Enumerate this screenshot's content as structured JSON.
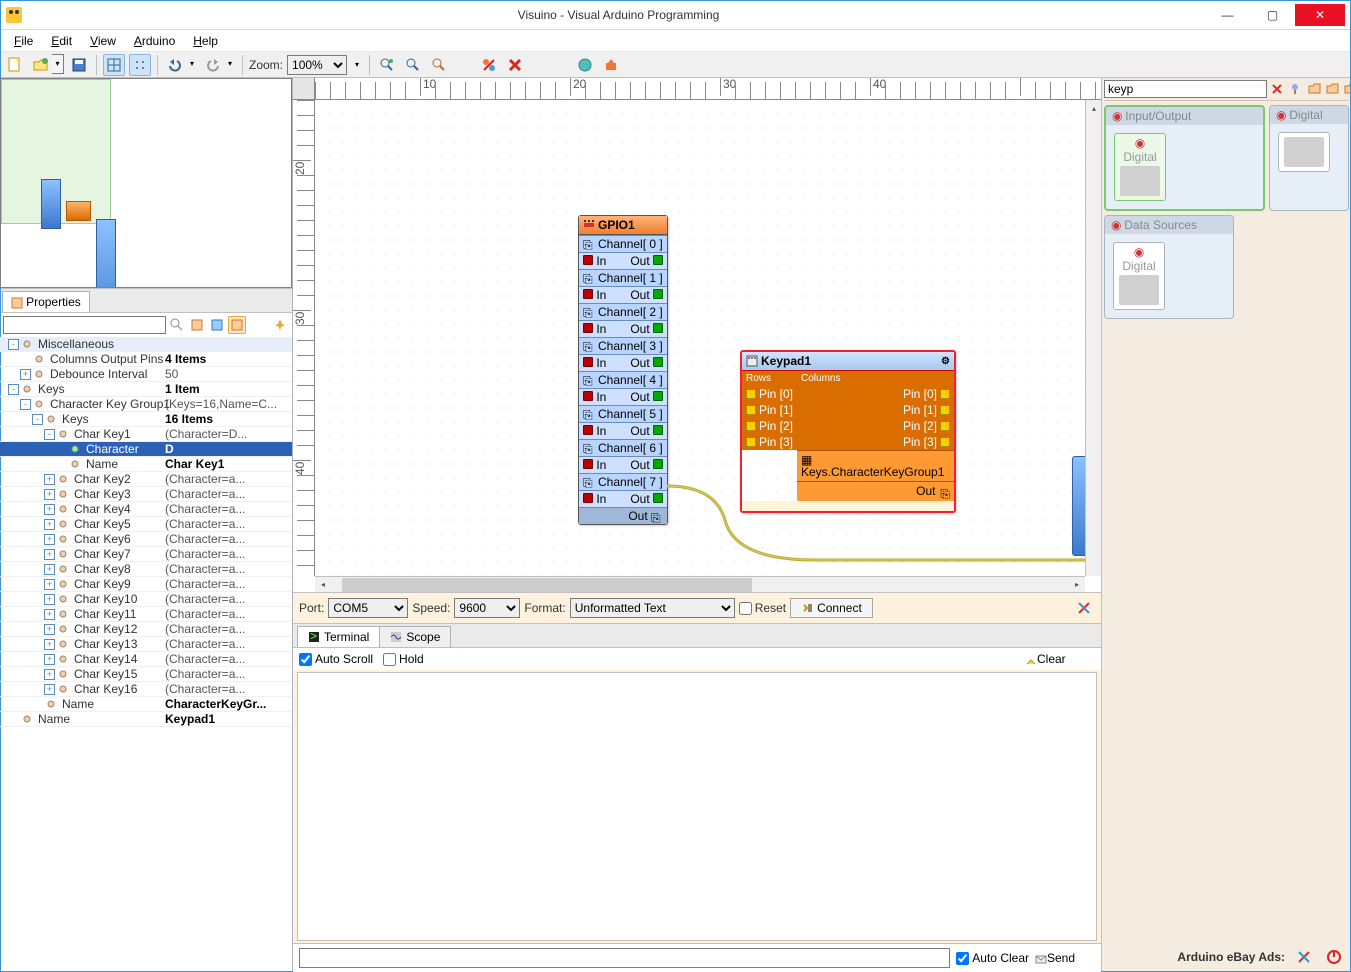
{
  "window": {
    "title": "Visuino - Visual Arduino Programming"
  },
  "menu": {
    "file": "File",
    "edit": "Edit",
    "view": "View",
    "arduino": "Arduino",
    "help": "Help"
  },
  "toolbar": {
    "zoom_label": "Zoom:",
    "zoom_value": "100%"
  },
  "properties": {
    "tab": "Properties",
    "tree": [
      {
        "lvl": 0,
        "exp": "-",
        "lbl": "Miscellaneous",
        "val": "",
        "hdr": true
      },
      {
        "lvl": 1,
        "exp": "",
        "lbl": "Columns Output Pins",
        "val": "4 Items",
        "bold": true
      },
      {
        "lvl": 1,
        "exp": "+",
        "lbl": "Debounce Interval",
        "val": "50"
      },
      {
        "lvl": 0,
        "exp": "-",
        "lbl": "Keys",
        "val": "1 Item",
        "bold": true
      },
      {
        "lvl": 1,
        "exp": "-",
        "lbl": "Character Key Group1",
        "val": "(Keys=16,Name=C..."
      },
      {
        "lvl": 2,
        "exp": "-",
        "lbl": "Keys",
        "val": "16 Items",
        "bold": true
      },
      {
        "lvl": 3,
        "exp": "-",
        "lbl": "Char Key1",
        "val": "(Character=D..."
      },
      {
        "lvl": 4,
        "exp": "",
        "lbl": "Character",
        "val": "D",
        "sel": true,
        "bold": true
      },
      {
        "lvl": 4,
        "exp": "",
        "lbl": "Name",
        "val": "Char Key1",
        "bold": true
      },
      {
        "lvl": 3,
        "exp": "+",
        "lbl": "Char Key2",
        "val": "(Character=a..."
      },
      {
        "lvl": 3,
        "exp": "+",
        "lbl": "Char Key3",
        "val": "(Character=a..."
      },
      {
        "lvl": 3,
        "exp": "+",
        "lbl": "Char Key4",
        "val": "(Character=a..."
      },
      {
        "lvl": 3,
        "exp": "+",
        "lbl": "Char Key5",
        "val": "(Character=a..."
      },
      {
        "lvl": 3,
        "exp": "+",
        "lbl": "Char Key6",
        "val": "(Character=a..."
      },
      {
        "lvl": 3,
        "exp": "+",
        "lbl": "Char Key7",
        "val": "(Character=a..."
      },
      {
        "lvl": 3,
        "exp": "+",
        "lbl": "Char Key8",
        "val": "(Character=a..."
      },
      {
        "lvl": 3,
        "exp": "+",
        "lbl": "Char Key9",
        "val": "(Character=a..."
      },
      {
        "lvl": 3,
        "exp": "+",
        "lbl": "Char Key10",
        "val": "(Character=a..."
      },
      {
        "lvl": 3,
        "exp": "+",
        "lbl": "Char Key11",
        "val": "(Character=a..."
      },
      {
        "lvl": 3,
        "exp": "+",
        "lbl": "Char Key12",
        "val": "(Character=a..."
      },
      {
        "lvl": 3,
        "exp": "+",
        "lbl": "Char Key13",
        "val": "(Character=a..."
      },
      {
        "lvl": 3,
        "exp": "+",
        "lbl": "Char Key14",
        "val": "(Character=a..."
      },
      {
        "lvl": 3,
        "exp": "+",
        "lbl": "Char Key15",
        "val": "(Character=a..."
      },
      {
        "lvl": 3,
        "exp": "+",
        "lbl": "Char Key16",
        "val": "(Character=a..."
      },
      {
        "lvl": 2,
        "exp": "",
        "lbl": "Name",
        "val": "CharacterKeyGr...",
        "bold": true
      },
      {
        "lvl": 0,
        "exp": "",
        "lbl": "Name",
        "val": "Keypad1",
        "bold": true
      }
    ]
  },
  "canvas": {
    "ruler_marks_h": [
      "10",
      "20",
      "30",
      "40"
    ],
    "ruler_marks_v": [
      "20",
      "30",
      "40"
    ],
    "gpio": {
      "title": "GPIO1",
      "channels": [
        "Channel[ 0 ]",
        "Channel[ 1 ]",
        "Channel[ 2 ]",
        "Channel[ 3 ]",
        "Channel[ 4 ]",
        "Channel[ 5 ]",
        "Channel[ 6 ]",
        "Channel[ 7 ]"
      ],
      "in": "In",
      "out": "Out"
    },
    "keypad": {
      "title": "Keypad1",
      "rows_label": "Rows",
      "cols_label": "Columns",
      "row_pins": [
        "Pin [0]",
        "Pin [1]",
        "Pin [2]",
        "Pin [3]"
      ],
      "col_pins": [
        "Pin [0]",
        "Pin [1]",
        "Pin [2]",
        "Pin [3]"
      ],
      "keys_group": "Keys.CharacterKeyGroup1",
      "out": "Out"
    }
  },
  "serial": {
    "port_label": "Port:",
    "port_value": "COM5",
    "speed_label": "Speed:",
    "speed_value": "9600",
    "format_label": "Format:",
    "format_value": "Unformatted Text",
    "reset": "Reset",
    "connect": "Connect",
    "tab_terminal": "Terminal",
    "tab_scope": "Scope",
    "auto_scroll": "Auto Scroll",
    "hold": "Hold",
    "clear": "Clear",
    "auto_clear": "Auto Clear",
    "send": "Send"
  },
  "palette": {
    "search": "keyp",
    "group_io": "Input/Output",
    "group_digital": "Digital",
    "group_datasources": "Data Sources",
    "item_digital": "Digital"
  },
  "ads": "Arduino eBay Ads:"
}
